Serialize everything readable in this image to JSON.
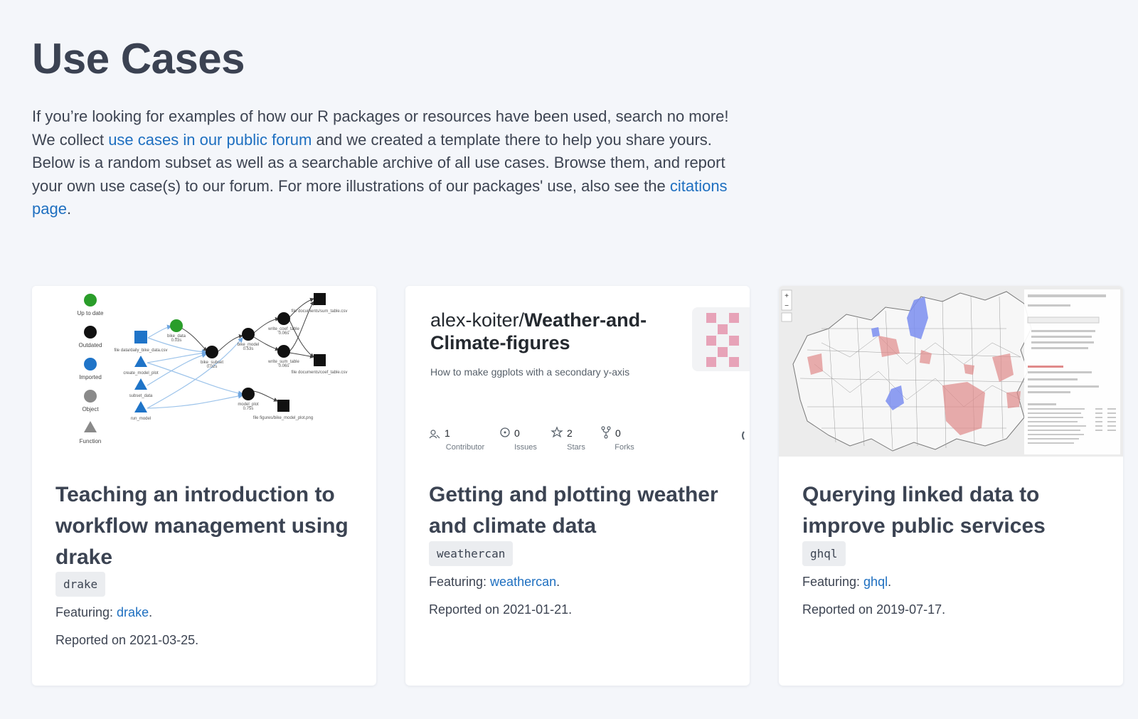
{
  "page": {
    "title": "Use Cases",
    "intro": {
      "part1": "If you’re looking for examples of how our R packages or resources have been used, search no more! We collect ",
      "forum_link": "use cases in our public forum",
      "part2": " and we created a template there to help you share yours. Below is a random subset as well as a searchable archive of all use cases. Browse them, and report your own use case(s) to our forum. For more illustrations of our packages' use, also see the ",
      "citations_link": "citations page",
      "part3": "."
    }
  },
  "cards": [
    {
      "title": "Teaching an introduction to workflow management using drake",
      "tag": "drake",
      "featuring_label": "Featuring: ",
      "featuring_link": "drake",
      "featuring_end": ".",
      "reported": "Reported on 2021-03-25.",
      "thumbnail": {
        "legend": [
          "Up to date",
          "Outdated",
          "Imported",
          "Object",
          "Function"
        ],
        "nodes": [
          "bike_data",
          "file data/daily_bike_data.csv",
          "create_model_plot",
          "subset_data",
          "run_model",
          "bike_subset",
          "bike_model",
          "write_coef_table",
          "write_sum_table",
          "model_plot",
          "file documents/sum_table.csv",
          "file documents/coef_table.csv",
          "file figures/bike_model_plot.png"
        ],
        "times": [
          "0.03s",
          "0.02s",
          "0.53s",
          "0.06s",
          "0.06s",
          "0.75s"
        ]
      }
    },
    {
      "title": "Getting and plotting weather and climate data",
      "tag": "weathercan",
      "featuring_label": "Featuring: ",
      "featuring_link": "weathercan",
      "featuring_end": ".",
      "reported": "Reported on 2021-01-21.",
      "thumbnail": {
        "owner": "alex-koiter/",
        "repo_line1": "Weather-and-",
        "repo_line2": "Climate-figures",
        "description": "How to make ggplots with a secondary y-axis",
        "stats": [
          {
            "num": "1",
            "label": "Contributor"
          },
          {
            "num": "0",
            "label": "Issues"
          },
          {
            "num": "2",
            "label": "Stars"
          },
          {
            "num": "0",
            "label": "Forks"
          }
        ]
      }
    },
    {
      "title": "Querying linked data to improve public services",
      "tag": "ghql",
      "featuring_label": "Featuring: ",
      "featuring_link": "ghql",
      "featuring_end": ".",
      "reported": "Reported on 2019-07-17.",
      "thumbnail": {
        "zoom_in": "+",
        "zoom_out": "−"
      }
    }
  ],
  "colors": {
    "background": "#f4f6fa",
    "link": "#1e6fc0",
    "title": "#3b4252",
    "tag_bg": "#ebedf0",
    "node_green": "#2a9d2a",
    "node_blue": "#1f74c8",
    "node_grey": "#8a8a8a",
    "map_highlight_blue": "#7b8ef0",
    "map_highlight_red": "#e8a0a0",
    "repo_icon_pink": "#e7a3b8"
  }
}
